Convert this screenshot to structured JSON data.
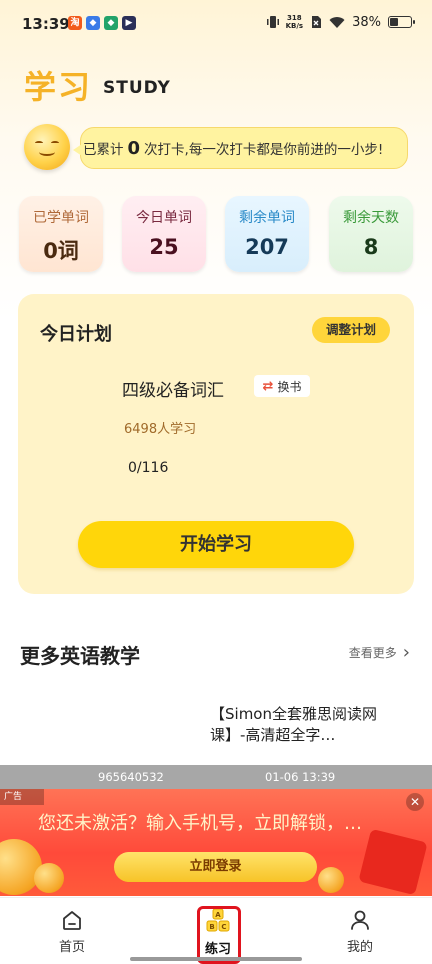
{
  "status": {
    "time": "13:39",
    "apps": [
      "淘",
      "◆",
      "◆",
      "▶"
    ],
    "net_speed_top": "318",
    "net_speed_bottom": "KB/s",
    "battery": "38%"
  },
  "header": {
    "title": "学习",
    "subtitle": "STUDY"
  },
  "checkin": {
    "prefix": "已累计",
    "count": "0",
    "suffix": "次打卡,每一次打卡都是你前进的一小步!"
  },
  "stats": [
    {
      "label": "已学单词",
      "value": "0词"
    },
    {
      "label": "今日单词",
      "value": "25"
    },
    {
      "label": "剩余单词",
      "value": "207"
    },
    {
      "label": "剩余天数",
      "value": "8"
    }
  ],
  "plan": {
    "title": "今日计划",
    "adjust_button": "调整计划",
    "book_name": "四级必备词汇",
    "swap_button": "换书",
    "learners": "6498人学习",
    "progress": "0/116",
    "start_button": "开始学习"
  },
  "more": {
    "title": "更多英语教学",
    "see_more": "查看更多",
    "course_title": "【Simon全套雅思阅读网课】-高清超全字…"
  },
  "ad": {
    "id": "965640532",
    "time": "01-06 13:39",
    "badge": "广告",
    "text": "您还未激活？输入手机号，立即解锁，…",
    "button": "立即登录"
  },
  "nav": [
    {
      "label": "首页",
      "icon": "home-icon"
    },
    {
      "label": "练习",
      "icon": "abc-blocks-icon"
    },
    {
      "label": "我的",
      "icon": "person-icon"
    }
  ],
  "colors": {
    "accent": "#f5b227",
    "button": "#ffd60a",
    "active_highlight": "#e0141e"
  }
}
